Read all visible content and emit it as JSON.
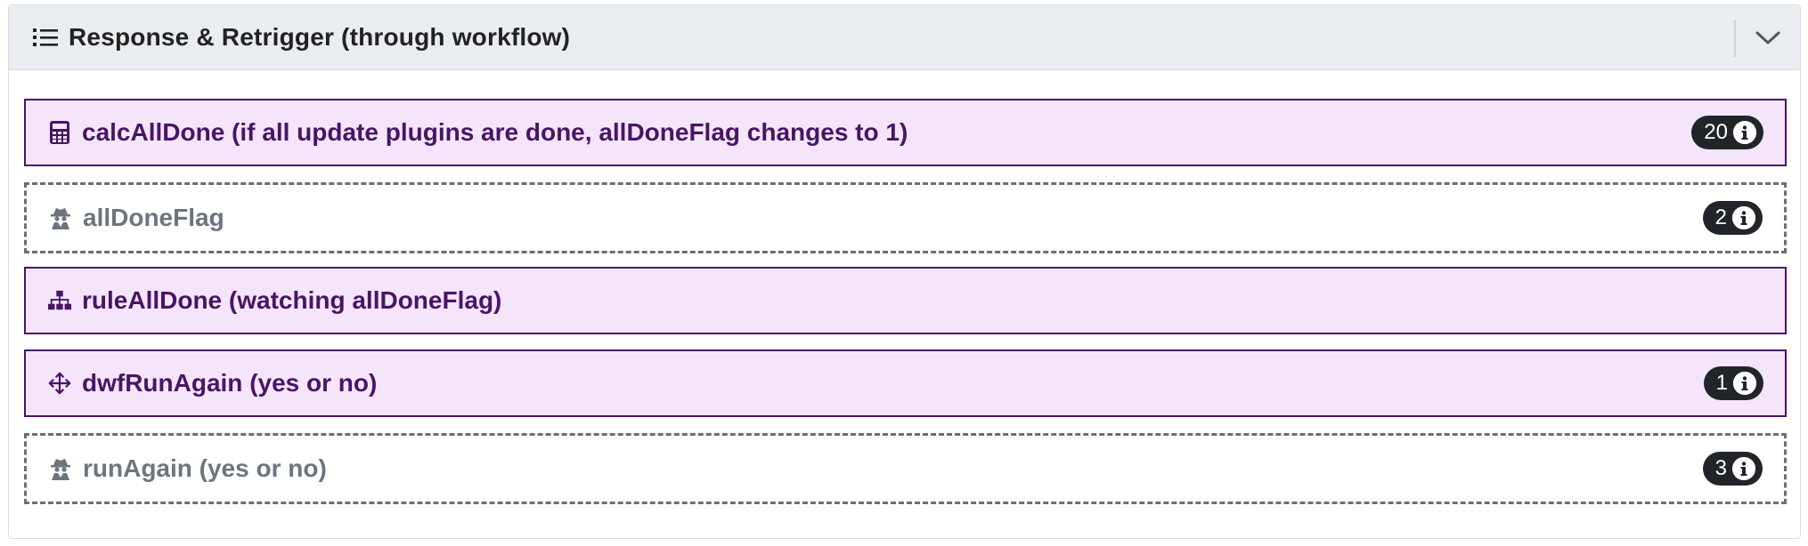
{
  "panel": {
    "title": "Response & Retrigger (through workflow)",
    "header_icon": "list-icon",
    "toggle_icon": "chevron-down-icon"
  },
  "items": [
    {
      "icon": "calculator-icon",
      "label": "calcAllDone (if all update plugins are done, allDoneFlag changes to 1)",
      "count": "20",
      "style": "solid"
    },
    {
      "icon": "spy-icon",
      "label": "allDoneFlag",
      "count": "2",
      "style": "dashed"
    },
    {
      "icon": "sitemap-icon",
      "label": "ruleAllDone (watching allDoneFlag)",
      "count": "",
      "style": "solid"
    },
    {
      "icon": "arrows-move-icon",
      "label": "dwfRunAgain (yes or no)",
      "count": "1",
      "style": "solid"
    },
    {
      "icon": "spy-icon",
      "label": "runAgain (yes or no)",
      "count": "3",
      "style": "dashed"
    }
  ],
  "colors": {
    "solid_bg": "#f4e5fb",
    "solid_border": "#4a1466",
    "solid_text": "#4a1466",
    "dashed_border": "#6a6f74",
    "dashed_text": "#6c757d",
    "badge_bg": "#212529"
  }
}
